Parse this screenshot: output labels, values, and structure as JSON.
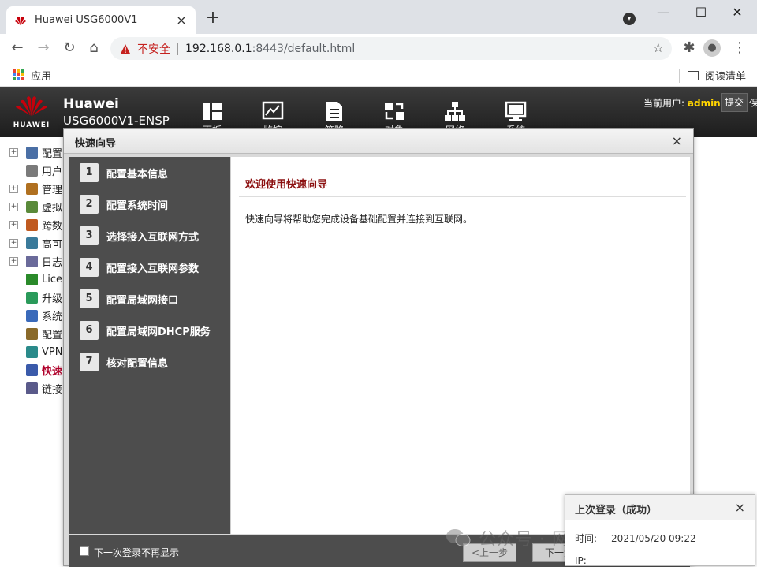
{
  "browser": {
    "tab_title": "Huawei USG6000V1",
    "new_tab": "+",
    "insecure_label": "不安全",
    "url_host": "192.168.0.1",
    "url_rest": ":8443/default.html",
    "bookmark_apps": "应用",
    "reading_list": "阅读清单"
  },
  "header": {
    "brand": "Huawei",
    "model": "USG6000V1-ENSP",
    "logo_text": "HUAWEI",
    "nav": [
      {
        "label": "面板",
        "icon": "dashboard-icon"
      },
      {
        "label": "监控",
        "icon": "monitor-icon"
      },
      {
        "label": "策略",
        "icon": "policy-icon"
      },
      {
        "label": "对象",
        "icon": "object-icon"
      },
      {
        "label": "网络",
        "icon": "network-icon"
      },
      {
        "label": "系统",
        "icon": "system-icon"
      }
    ],
    "current_user_label": "当前用户:",
    "current_user": "admin",
    "submit": "提交",
    "cut_text": "保"
  },
  "tree": [
    {
      "label": "配置",
      "expandable": true,
      "icon": "config-icon"
    },
    {
      "label": "用户",
      "expandable": false,
      "icon": "user-icon"
    },
    {
      "label": "管理",
      "expandable": true,
      "icon": "admin-icon"
    },
    {
      "label": "虚拟",
      "expandable": true,
      "icon": "virtual-icon"
    },
    {
      "label": "跨数",
      "expandable": true,
      "icon": "crossdata-icon"
    },
    {
      "label": "高可",
      "expandable": true,
      "icon": "ha-icon"
    },
    {
      "label": "日志",
      "expandable": true,
      "icon": "log-icon"
    },
    {
      "label": "Licen",
      "expandable": false,
      "icon": "license-icon"
    },
    {
      "label": "升级",
      "expandable": false,
      "icon": "upgrade-icon"
    },
    {
      "label": "系统",
      "expandable": false,
      "icon": "system-tree-icon"
    },
    {
      "label": "配置",
      "expandable": false,
      "icon": "config2-icon"
    },
    {
      "label": "VPN",
      "expandable": false,
      "icon": "vpn-icon"
    },
    {
      "label": "快速",
      "expandable": false,
      "icon": "quick-icon",
      "active": true
    },
    {
      "label": "链接",
      "expandable": false,
      "icon": "link-icon"
    }
  ],
  "wizard": {
    "title": "快速向导",
    "close": "×",
    "steps": [
      {
        "num": "1",
        "label": "配置基本信息"
      },
      {
        "num": "2",
        "label": "配置系统时间"
      },
      {
        "num": "3",
        "label": "选择接入互联网方式"
      },
      {
        "num": "4",
        "label": "配置接入互联网参数"
      },
      {
        "num": "5",
        "label": "配置局域网接口"
      },
      {
        "num": "6",
        "label": "配置局域网DHCP服务"
      },
      {
        "num": "7",
        "label": "核对配置信息"
      }
    ],
    "welcome_title": "欢迎使用快速向导",
    "description": "快速向导将帮助您完成设备基础配置并连接到互联网。",
    "dont_show_label": "下一次登录不再显示",
    "prev_button": "<上一步",
    "next_button": "下一步"
  },
  "last_login": {
    "title": "上次登录（成功）",
    "close": "×",
    "time_label": "时间:",
    "time_value": "2021/05/20 09:22",
    "ip_label": "IP:",
    "ip_value": "-"
  },
  "watermark": "公众号 · 网络工程师俱乐部",
  "colors": {
    "header_bg": "#2b2b2b",
    "brand_red": "#c7000b",
    "user_yellow": "#ffd400",
    "wizard_panel": "#4d4d4d",
    "welcome_red": "#8c1010"
  }
}
